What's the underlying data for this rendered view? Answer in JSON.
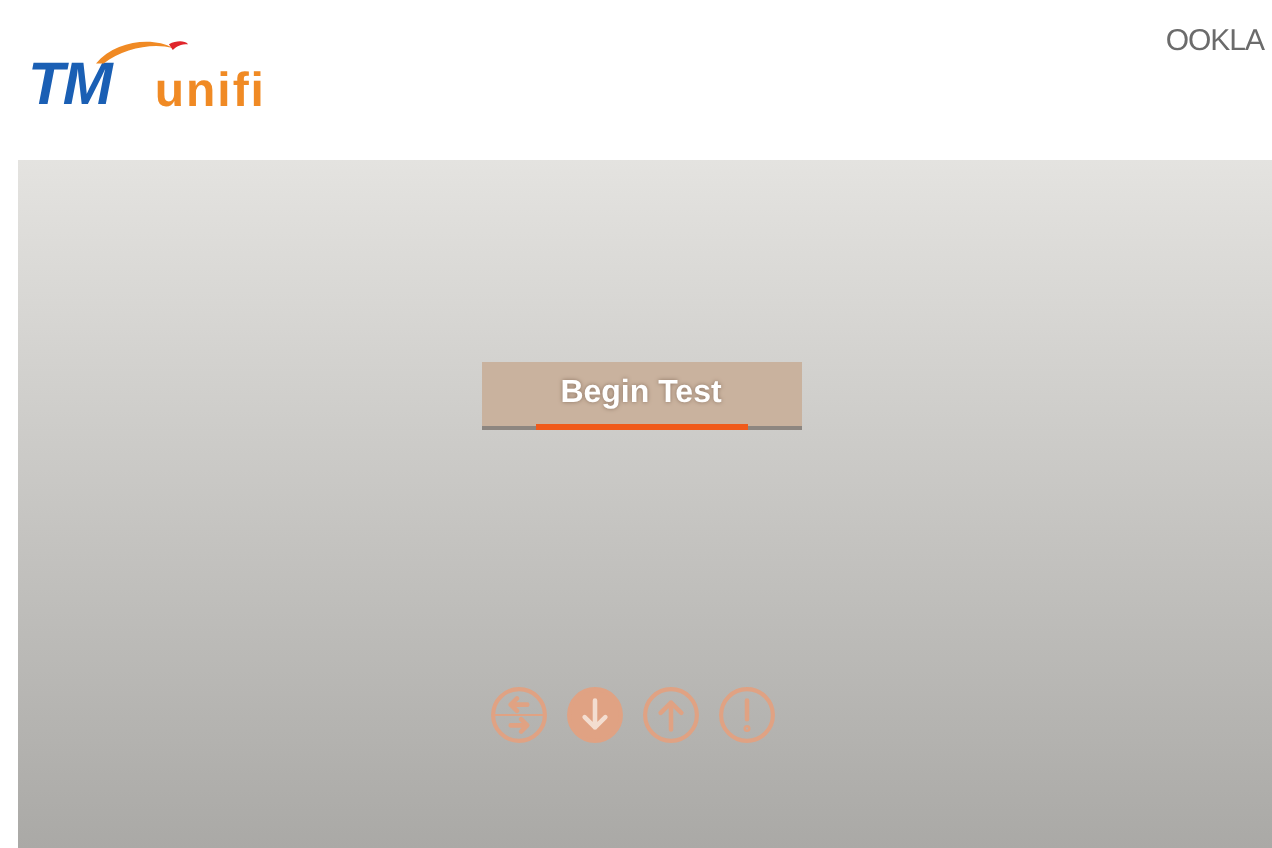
{
  "header": {
    "brand": "TM",
    "product": "unifi",
    "partner": "OOKLA"
  },
  "begin_button": {
    "label": "Begin Test"
  },
  "steps": [
    {
      "kind": "ping",
      "selected": false
    },
    {
      "kind": "download",
      "selected": true
    },
    {
      "kind": "upload",
      "selected": false
    },
    {
      "kind": "alert",
      "selected": false
    }
  ]
}
